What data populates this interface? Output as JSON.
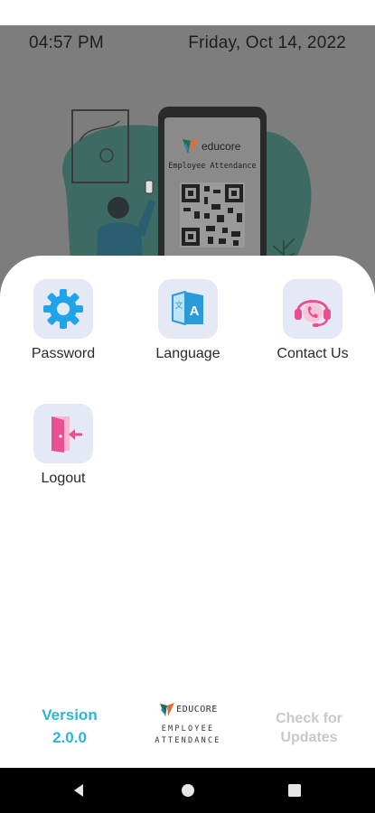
{
  "header": {
    "time": "04:57 PM",
    "date": "Friday, Oct 14, 2022"
  },
  "illustration": {
    "brand": "educore",
    "subtitle": "Employee Attendance"
  },
  "menu": {
    "items": [
      {
        "label": "Password",
        "icon": "gear-icon"
      },
      {
        "label": "Language",
        "icon": "translate-icon"
      },
      {
        "label": "Contact Us",
        "icon": "headset-phone-icon"
      },
      {
        "label": "Logout",
        "icon": "logout-door-icon"
      }
    ]
  },
  "footer": {
    "version_label": "Version",
    "version_number": "2.0.0",
    "logo_brand": "EDUCORE",
    "logo_line1": "EMPLOYEE",
    "logo_line2": "ATTENDANCE",
    "update_line1": "Check for",
    "update_line2": "Updates"
  },
  "navbar": {
    "back": "back-icon",
    "home": "home-icon",
    "recents": "recents-icon"
  },
  "colors": {
    "accent": "#29b6d8",
    "icon_bg": "#e5e9f6",
    "logout_pink": "#e8508f",
    "backdrop": "#7d7d7d",
    "disabled_text": "#c8c8c8"
  }
}
